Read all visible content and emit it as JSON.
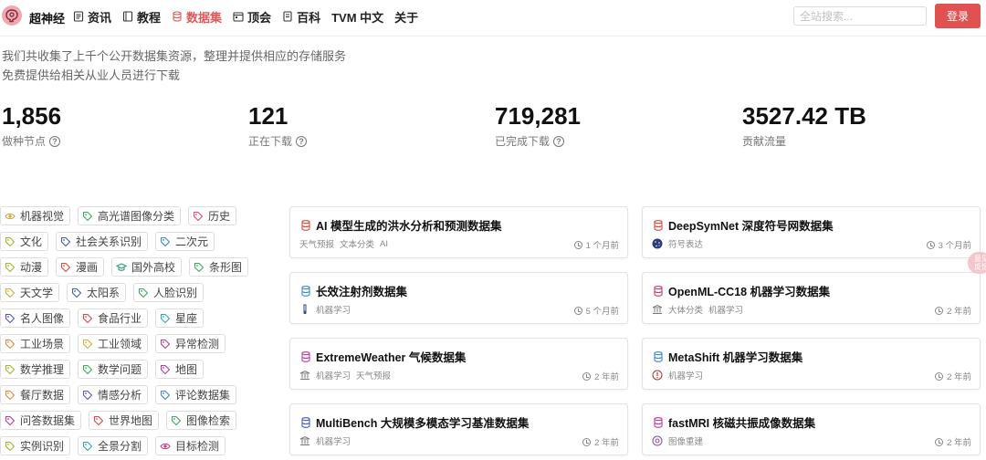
{
  "header": {
    "brand": "超神经",
    "nav": [
      {
        "label": "资讯",
        "icon": "document-icon"
      },
      {
        "label": "教程",
        "icon": "book-icon"
      },
      {
        "label": "数据集",
        "icon": "database-icon",
        "active": true
      },
      {
        "label": "顶会",
        "icon": "calendar-icon"
      },
      {
        "label": "百科",
        "icon": "page-icon"
      },
      {
        "label": "TVM 中文",
        "icon": ""
      },
      {
        "label": "关于",
        "icon": ""
      }
    ],
    "search_placeholder": "全站搜索...",
    "login_label": "登录",
    "accent_color": "#e0524f"
  },
  "intro": {
    "line1": "我们共收集了上千个公开数据集资源，整理并提供相应的存储服务",
    "line2": "免费提供给相关从业人员进行下载"
  },
  "stats": [
    {
      "value": "1,856",
      "label": "做种节点",
      "help": true
    },
    {
      "value": "121",
      "label": "正在下载",
      "help": true
    },
    {
      "value": "719,281",
      "label": "已完成下载",
      "help": true
    },
    {
      "value": "3527.42 TB",
      "label": "贡献流量",
      "help": false
    }
  ],
  "tags": [
    [
      {
        "label": "机器视觉",
        "icon": "eye-icon",
        "color": "#c9a43a"
      },
      {
        "label": "高光谱图像分类",
        "icon": "tag-icon",
        "color": "#3ba862"
      },
      {
        "label": "历史",
        "icon": "tag-icon",
        "color": "#e04a73"
      }
    ],
    [
      {
        "label": "文化",
        "icon": "tag-icon",
        "color": "#9cb82e"
      },
      {
        "label": "社会关系识别",
        "icon": "tag-icon",
        "color": "#4a57c9"
      },
      {
        "label": "二次元",
        "icon": "tag-icon",
        "color": "#3a86d0"
      }
    ],
    [
      {
        "label": "动漫",
        "icon": "tag-icon",
        "color": "#9cb82e"
      },
      {
        "label": "漫画",
        "icon": "tag-icon",
        "color": "#d9483b"
      },
      {
        "label": "国外高校",
        "icon": "graduation-cap-icon",
        "color": "#2ea07a"
      },
      {
        "label": "条形图",
        "icon": "tag-icon",
        "color": "#3ba862"
      }
    ],
    [
      {
        "label": "天文学",
        "icon": "tag-icon",
        "color": "#c9b23a"
      },
      {
        "label": "太阳系",
        "icon": "tag-icon",
        "color": "#4a57c9"
      },
      {
        "label": "人脸识别",
        "icon": "tag-icon",
        "color": "#3ba862"
      }
    ],
    [
      {
        "label": "名人图像",
        "icon": "tag-icon",
        "color": "#4a57c9"
      },
      {
        "label": "食品行业",
        "icon": "tag-icon",
        "color": "#d9483b"
      },
      {
        "label": "星座",
        "icon": "tag-icon",
        "color": "#2fa6b8"
      }
    ],
    [
      {
        "label": "工业场景",
        "icon": "tag-icon",
        "color": "#d98a3b"
      },
      {
        "label": "工业领域",
        "icon": "tag-icon",
        "color": "#c9b23a"
      },
      {
        "label": "异常检测",
        "icon": "tag-icon",
        "color": "#c03a7a"
      }
    ],
    [
      {
        "label": "数学推理",
        "icon": "tag-icon",
        "color": "#9cb82e"
      },
      {
        "label": "数学问题",
        "icon": "tag-icon",
        "color": "#3ba862"
      },
      {
        "label": "地图",
        "icon": "tag-icon",
        "color": "#c03a9a"
      }
    ],
    [
      {
        "label": "餐厅数据",
        "icon": "tag-icon",
        "color": "#d98a3b"
      },
      {
        "label": "情感分析",
        "icon": "tag-icon",
        "color": "#6a4ac9"
      },
      {
        "label": "评论数据集",
        "icon": "tag-icon",
        "color": "#3a86d0"
      }
    ],
    [
      {
        "label": "问答数据集",
        "icon": "tag-icon",
        "color": "#c03a9a"
      },
      {
        "label": "世界地图",
        "icon": "tag-icon",
        "color": "#d9483b"
      },
      {
        "label": "图像检索",
        "icon": "tag-icon",
        "color": "#3ba862"
      }
    ],
    [
      {
        "label": "实例识别",
        "icon": "tag-icon",
        "color": "#9cb82e"
      },
      {
        "label": "全景分割",
        "icon": "tag-icon",
        "color": "#2fa6b8"
      },
      {
        "label": "目标检测",
        "icon": "eye-icon",
        "color": "#c03a7a"
      }
    ]
  ],
  "cards": [
    {
      "title": "AI 模型生成的洪水分析和预测数据集",
      "db_color": "#d9483b",
      "meta_icon": "",
      "labels": [
        "天气预报",
        "文本分类",
        "AI"
      ],
      "time": "1 个月前"
    },
    {
      "title": "DeepSymNet 深度符号网数据集",
      "db_color": "#d9483b",
      "meta_icon": "constellation-icon",
      "labels": [
        "符号表达"
      ],
      "time": "3 个月前"
    },
    {
      "title": "长效注射剂数据集",
      "db_color": "#3a86d0",
      "meta_icon": "syringe-icon",
      "labels": [
        "机器学习"
      ],
      "time": "5 个月前"
    },
    {
      "title": "OpenML-CC18 机器学习数据集",
      "db_color": "#c03a7a",
      "meta_icon": "institution-icon",
      "labels": [
        "大体分类",
        "机器学习"
      ],
      "time": "2 年前"
    },
    {
      "title": "ExtremeWeather 气候数据集",
      "db_color": "#c03a9a",
      "meta_icon": "institution-icon",
      "labels": [
        "机器学习",
        "天气预报"
      ],
      "time": "2 年前"
    },
    {
      "title": "MetaShift 机器学习数据集",
      "db_color": "#3a86d0",
      "meta_icon": "warning-circle-icon",
      "labels": [
        "机器学习"
      ],
      "time": "2 年前"
    },
    {
      "title": "MultiBench 大规模多模态学习基准数据集",
      "db_color": "#4a57c9",
      "meta_icon": "institution-icon",
      "labels": [
        "机器学习"
      ],
      "time": "2 年前"
    },
    {
      "title": "fastMRI 核磁共振成像数据集",
      "db_color": "#c03a9a",
      "meta_icon": "lab-logo-icon",
      "labels": [
        "图像重建"
      ],
      "time": "2 年前"
    }
  ],
  "float_badge": "意见\n反馈"
}
